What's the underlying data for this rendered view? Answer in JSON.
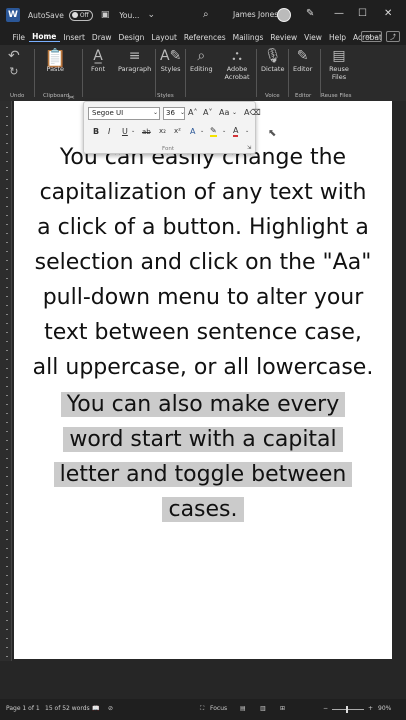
{
  "titlebar": {
    "autosave_label": "AutoSave",
    "autosave_state": "Off",
    "doc_title": "You...",
    "dropdown_glyph": "⌄",
    "user_name": "James Jones"
  },
  "menu": {
    "tabs": [
      "File",
      "Home",
      "Insert",
      "Draw",
      "Design",
      "Layout",
      "References",
      "Mailings",
      "Review",
      "View",
      "Help",
      "Acrobat"
    ],
    "active": "Home"
  },
  "ribbon": {
    "paste_label": "Paste",
    "font_label": "Font",
    "paragraph_label": "Paragraph",
    "styles_label": "Styles",
    "editing_label": "Editing",
    "adobe_label": "Adobe Acrobat",
    "dictate_label": "Dictate",
    "editor_label": "Editor",
    "reuse_label": "Reuse Files",
    "groups": {
      "undo": "Undo",
      "clipboard": "Clipboard",
      "styles": "Styles",
      "voice": "Voice",
      "editor": "Editor",
      "reuse": "Reuse Files"
    }
  },
  "font_popup": {
    "font_name": "Segoe UI",
    "font_size": "36",
    "grow": "A˄",
    "shrink": "A˅",
    "case": "Aa",
    "bold": "B",
    "italic": "I",
    "underline": "U",
    "strike": "ab",
    "subscript": "x₂",
    "superscript": "x²",
    "label": "Font"
  },
  "document": {
    "paragraph1": "You can easily change the capitalization of any text with a click of a button. Highlight a selection and click on the \"Aa\" pull-down menu to alter your text between sentence case, all uppercase, or all lowercase.",
    "para2_lines": [
      "You can also make every",
      "word start with a capital",
      "letter and toggle between",
      "cases."
    ]
  },
  "status": {
    "page": "Page 1 of 1",
    "words": "15 of 52 words",
    "focus": "Focus",
    "zoom": "90%"
  },
  "colors": {
    "accent": "#2b5797",
    "highlight": "#cbcbcb",
    "font_color_red": "#d13438",
    "highlighter_yellow": "#f4e300"
  }
}
